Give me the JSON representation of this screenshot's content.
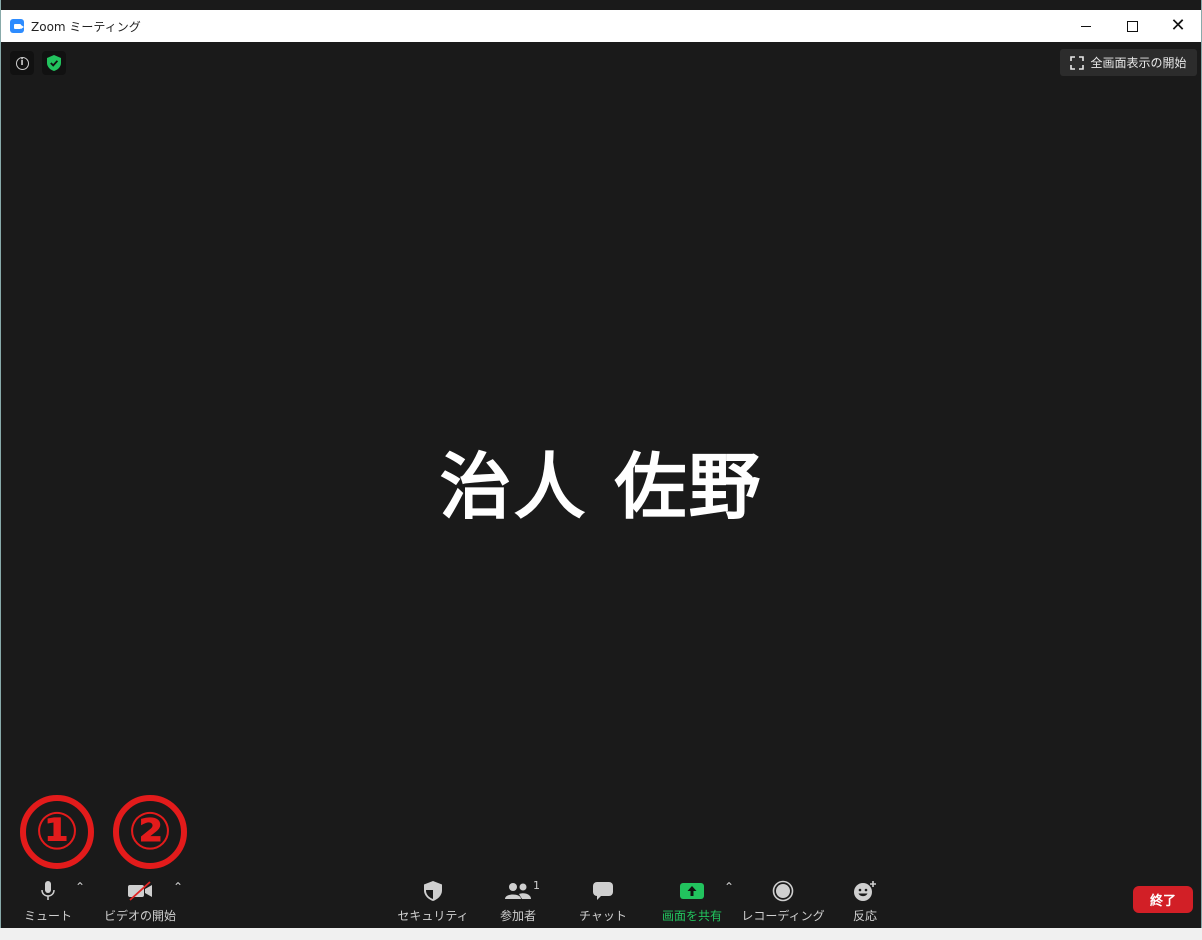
{
  "window": {
    "title": "Zoom ミーティング"
  },
  "top": {
    "fullscreen_label": "全画面表示の開始"
  },
  "participant": {
    "name": "治人 佐野"
  },
  "annotations": [
    "①",
    "②"
  ],
  "toolbar": {
    "mute_label": "ミュート",
    "video_label": "ビデオの開始",
    "security_label": "セキュリティ",
    "participants_label": "参加者",
    "participants_count": "1",
    "chat_label": "チャット",
    "share_label": "画面を共有",
    "record_label": "レコーディング",
    "reactions_label": "反応",
    "end_label": "終了"
  },
  "colors": {
    "background": "#1a1a1a",
    "share_green": "#22c35e",
    "end_red": "#d21f26",
    "annotation_red": "#e31b1b",
    "shield_green": "#22c35e"
  }
}
